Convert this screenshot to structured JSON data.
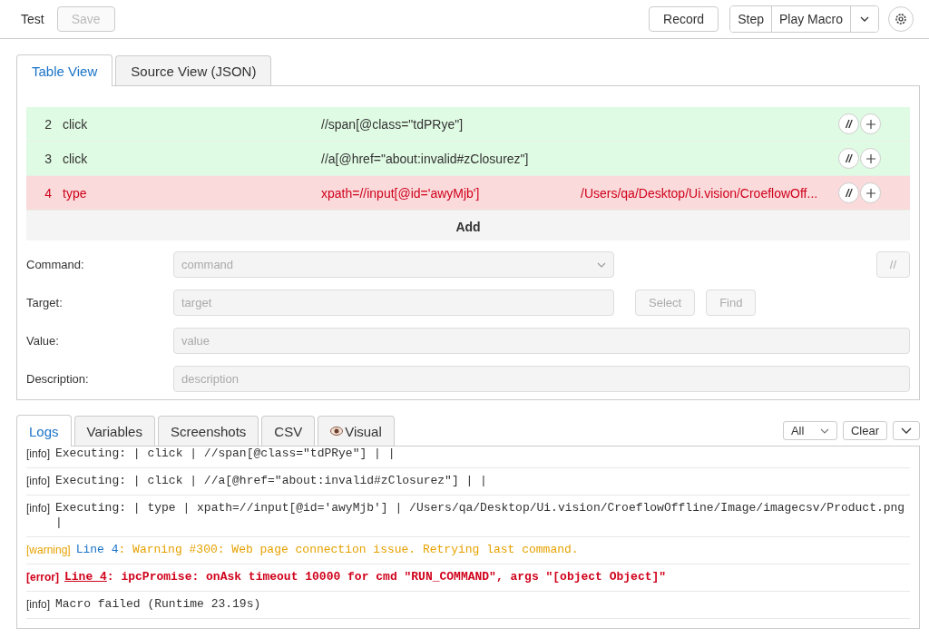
{
  "toolbar": {
    "macro_name": "Test",
    "save": {
      "label": "Save",
      "disabled": true
    },
    "record": "Record",
    "step": "Step",
    "play": "Play Macro"
  },
  "editor_tabs": [
    {
      "label": "Table View",
      "selected": true
    },
    {
      "label": "Source View (JSON)",
      "selected": false
    }
  ],
  "commands": [
    {
      "index": "2",
      "command": "click",
      "target": "//span[@class=\"tdPRye\"]",
      "kind": "passed"
    },
    {
      "index": "3",
      "command": "click",
      "target": "//a[@href=\"about:invalid#zClosurez\"]",
      "kind": "passed"
    },
    {
      "index": "4",
      "command": "type",
      "target": "xpath=//input[@id='awyMjb']",
      "value": "/Users/qa/Desktop/Ui.vision/CroeflowOff...",
      "kind": "failed"
    }
  ],
  "comment_label": "//",
  "add_label": "Add",
  "form": {
    "command": {
      "label": "Command:",
      "placeholder": "command"
    },
    "target": {
      "label": "Target:",
      "placeholder": "target"
    },
    "value": {
      "label": "Value:",
      "placeholder": "value"
    },
    "description": {
      "label": "Description:",
      "placeholder": "description"
    },
    "comment_button": {
      "label": "//",
      "disabled": true
    },
    "select_button": {
      "label": "Select",
      "disabled": true
    },
    "find_button": {
      "label": "Find",
      "disabled": true
    }
  },
  "log_tabs": [
    {
      "label": "Logs",
      "selected": true
    },
    {
      "label": "Variables",
      "selected": false
    },
    {
      "label": "Screenshots",
      "selected": false
    },
    {
      "label": "CSV",
      "selected": false
    },
    {
      "label": "Visual",
      "selected": false,
      "icon": true
    }
  ],
  "log_filter": "All",
  "clear": "Clear",
  "logs": [
    {
      "kind": "info",
      "tag": "[info]",
      "text": "Executing:  | click | //span[@class=\"tdPRye\"] |  |"
    },
    {
      "kind": "info",
      "tag": "[info]",
      "text": "Executing:  | click | //a[@href=\"about:invalid#zClosurez\"] |  |"
    },
    {
      "kind": "info",
      "tag": "[info]",
      "text": "Executing:  | type | xpath=//input[@id='awyMjb'] | /Users/qa/Desktop/Ui.vision/CroeflowOffline/Image/imagecsv/Product.png |"
    },
    {
      "kind": "warning",
      "tag": "[warning]",
      "link": "Line 4",
      "text": ": Warning #300: Web page connection issue. Retrying last command."
    },
    {
      "kind": "error",
      "tag": "[error]",
      "link": "Line 4",
      "text": ": ipcPromise: onAsk timeout 10000 for cmd \"RUN_COMMAND\", args \"[object Object]\""
    },
    {
      "kind": "info",
      "tag": "[info]",
      "text": "Macro failed (Runtime 23.19s)"
    }
  ]
}
